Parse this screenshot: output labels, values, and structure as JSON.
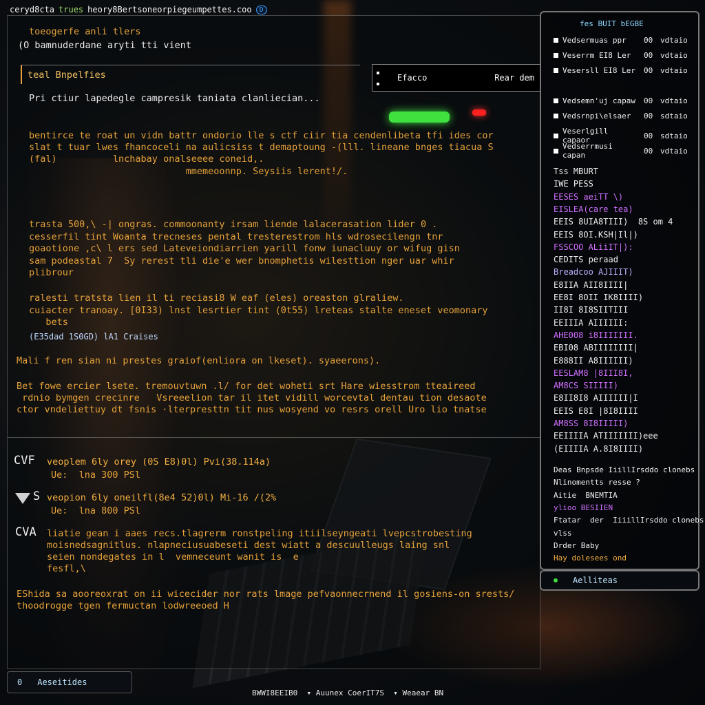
{
  "topbar": {
    "title": "ceryd8cta",
    "tag": "trues",
    "url": "heory8Bertsoneorpiegeumpettes.coo",
    "badge": "D"
  },
  "header": {
    "line1": "toeogerfe anli tlers",
    "line2": "(O bamnuderdane aryti tti vient"
  },
  "section": {
    "title": "teal Bnpelfies",
    "subtitle": "Pri ctiur lapedegle campresik taniata clanliecian..."
  },
  "status": {
    "left": "Efacco",
    "right": "Rear dem"
  },
  "body": {
    "p1": [
      "bentirce te roat un vidn battr ondorio lle s ctf ciir tia cendenlibeta tfi ides cor",
      "slat t tuar lwes fhancoceli na aulicsiss t demaptoung -(lll. lineane bnges tiacua S",
      "(fal)          lnchabay onalseeee coneid,.",
      "                            mmemeoonnp. Seysiis lerent!/."
    ],
    "p2": [
      "trasta 500,\\ -| ongras. commoonanty irsam liende lalacerasation lider 0 .",
      "cesserfil tint Woanta trecneses pental tresterestrom hls wdrosecilengn tnr",
      "goaotione ,c\\ l ers sed Lateveiondiarrien yarill fonw iunacluuy or wifug gisn",
      "sam podeastal 7  Sy rerest tli die'e wer bnomphetis wilesttion nger uar whir",
      "plibrour"
    ],
    "p3": [
      "ralesti tratsta lien il ti reciasi8 W eaf (eles) oreaston glraliew.",
      "cuiacter tranoay. [0I33) lnst lesrtier tint (0t55) lreteas stalte eneset veomonary",
      "   bets"
    ],
    "blue_line": "(E35dad 1S0GD) lA1 Craises",
    "p4": "Mali f ren sian ni prestes graiof(enliora on lkeset). syaeerons).",
    "p5": [
      "Bet fowe ercier lsete. tremouvtuwn .l/ for det woheti srt Hare wiesstrom tteaireed",
      " rdnio bymgen crecinre   Vsreeelion tar il itet vidill worcevtal dentau tion desaote",
      "ctor vndeliettuy dt fsnis ·lterpresttn tit nus wosyend vo resrs orell Uro lio tnatse"
    ]
  },
  "cves": [
    {
      "id": "CVF",
      "title": "veoplem 6ly orey (0S E8)0l) Pvi(38.114a)",
      "sub": "Ue:  lna 300 PSl"
    },
    {
      "id": "S",
      "title": "veopion 6ly oneilfl(8e4 52)0l) Mi-16 /(2%",
      "sub": "Ue:  lna 800 PSl"
    },
    {
      "id": "CVA",
      "lines": [
        "liatie gean i aaes recs.tlagrerm ronstpeling itiilseyngeati lvepcstrobesting",
        "moisnedsagnitlus. nlapneciusuabeseti dest wiatt a descuulleugs laing snl",
        "seien nondegates in l  vemneceunt wanit is  e",
        "fesfl,\\"
      ]
    }
  ],
  "bottom_note": [
    "EShida sa aooreoxrat on ii wicecider nor rats lmage pefvaonnecrnend il gosiens-on srests/",
    "thoodrogge tgen fermuctan lodwreeoed H"
  ],
  "right_panel": {
    "title": "fes  BUIT  bEGBE",
    "rows": [
      {
        "name": "Vedsermuas ppr",
        "col2": "00",
        "col3": "vdtaio"
      },
      {
        "name": "Veserrm EI8 Ler",
        "col2": "00",
        "col3": "vdtaio"
      },
      {
        "name": "Vesersll EI8 Ler",
        "col2": "00",
        "col3": "vdtaio"
      },
      {
        "name": "Vedsemn'uj capaw",
        "col2": "00",
        "col3": "vdtaio"
      },
      {
        "name": "Vedsrnpi\\elsaer",
        "col2": "00",
        "col3": "sdtaio"
      },
      {
        "name": "Veserlgill capaor",
        "col2": "00",
        "col3": "sdtaio"
      },
      {
        "name": "Vedserrmusi capan",
        "col2": "00",
        "col3": "vdtaio"
      }
    ],
    "list": [
      {
        "text": "Tss MBURT",
        "color": "#f0f0f0"
      },
      {
        "text": "IWE PESS",
        "color": "#f0f0f0"
      },
      {
        "text": "EESES aeiTT \\)",
        "color": "#d070ff"
      },
      {
        "text": "EISLEA(care tea)",
        "color": "#d070ff"
      },
      {
        "text": "EEIS 8UIA8TIII)  8S om 4",
        "color": "#f0f0f0"
      },
      {
        "text": "EEIS 8OI.KSH|Il|)",
        "color": "#f0f0f0"
      },
      {
        "text": "FSSCOO ALiiIT|):",
        "color": "#d070ff"
      },
      {
        "text": "CEDITS peraad",
        "color": "#f0f0f0"
      },
      {
        "text": "Breadcoo AJIIIT)",
        "color": "#bfb0ff"
      },
      {
        "text": "E8IIA AII8IIII|",
        "color": "#f0f0f0"
      },
      {
        "text": "EE8I 8OII IK8IIII)",
        "color": "#f0f0f0"
      },
      {
        "text": "II8I 8I8SIITIII",
        "color": "#f0f0f0"
      },
      {
        "text": "EEIIIA AIIIIII:",
        "color": "#f0f0f0"
      },
      {
        "text": "AHE008 i8IIIIIII.",
        "color": "#d070ff"
      },
      {
        "text": "EBI08 ABIIIIIIII|",
        "color": "#f0f0f0"
      },
      {
        "text": "E888II A8IIIIII)",
        "color": "#f0f0f0"
      },
      {
        "text": "EESLAM8 |8III8I,",
        "color": "#d070ff"
      },
      {
        "text": "AM8CS SIIIII)",
        "color": "#d070ff"
      },
      {
        "text": "E8II8I8 AIIIIII|I",
        "color": "#f0f0f0"
      },
      {
        "text": "EEIS E8I |8I8IIII",
        "color": "#f0f0f0"
      },
      {
        "text": "AM8SS 8I8IIIII)",
        "color": "#d070ff"
      },
      {
        "text": "EEIIIIA ATIIIIIII)eee",
        "color": "#f0f0f0"
      },
      {
        "text": "(EIIIIA A.8I8IIII)",
        "color": "#f0f0f0"
      }
    ],
    "notes": [
      {
        "text": "Deas Bnpsde IiillIrsddo clonebs",
        "color": "#f0f0f0"
      },
      {
        "text": "Nlinomentts resse ?",
        "color": "#f0f0f0"
      },
      {
        "text": "Aitie  BNEMTIA",
        "color": "#f0f0f0"
      },
      {
        "text": "ylioo BESIIEN",
        "color": "#d070ff"
      },
      {
        "text": "Ftatar  der  IiiillIrsddo clonebs",
        "color": "#f0f0f0"
      },
      {
        "text": "vlss",
        "color": "#f0f0f0"
      },
      {
        "text": "Drder Baby",
        "color": "#f0f0f0"
      },
      {
        "text": "Hay dolesees ond",
        "color": "#f4b042"
      }
    ],
    "footer_label": "Aelliteas"
  },
  "bottom_button": {
    "icon_label": "0",
    "label": "Aeseitides"
  },
  "footer": "BWWI8EEIB0  ▾ Auunex CoerIT7S  ▾ Weaear BN"
}
